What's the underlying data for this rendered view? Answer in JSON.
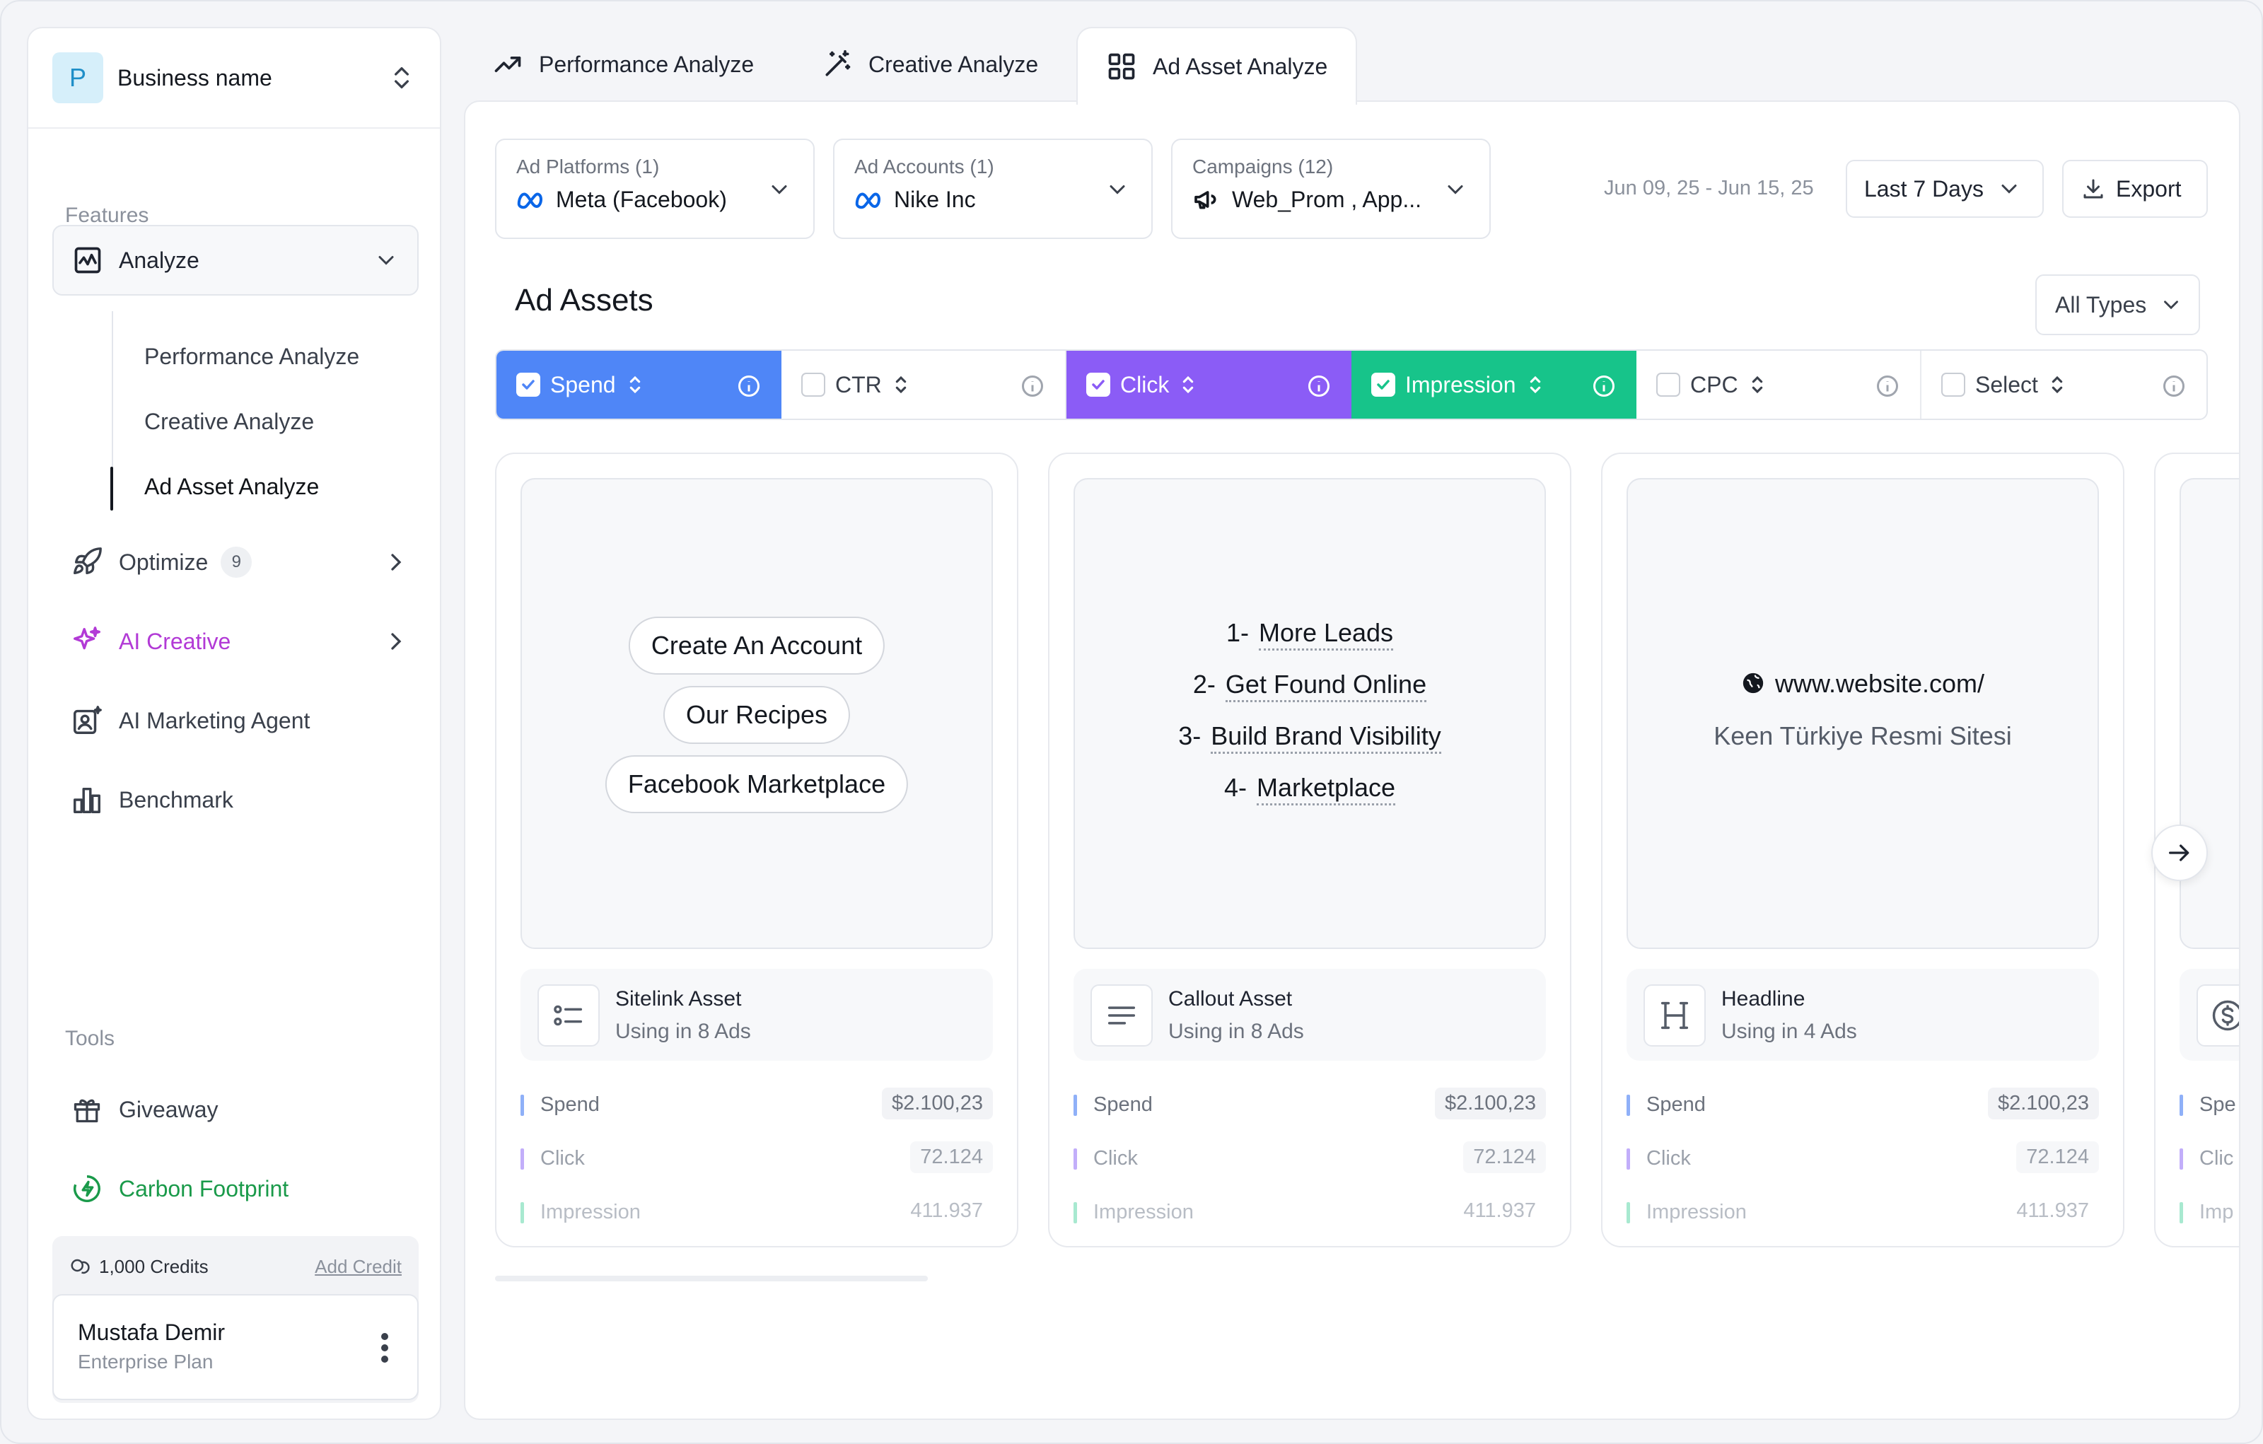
{
  "business": {
    "avatar_letter": "P",
    "name": "Business name"
  },
  "sidebar": {
    "features_label": "Features",
    "analyze_label": "Analyze",
    "sub_items": [
      {
        "label": "Performance Analyze"
      },
      {
        "label": "Creative Analyze"
      },
      {
        "label": "Ad Asset Analyze"
      }
    ],
    "optimize": {
      "label": "Optimize",
      "badge": "9"
    },
    "ai_creative": {
      "label": "AI Creative",
      "color": "#b23ad6"
    },
    "ai_agent": {
      "label": "AI Marketing Agent"
    },
    "benchmark": {
      "label": "Benchmark"
    },
    "tools_label": "Tools",
    "giveaway": {
      "label": "Giveaway"
    },
    "carbon": {
      "label": "Carbon Footprint",
      "color": "#1a9a4a"
    },
    "credits": {
      "amount": "1,000 Credits",
      "add_label": "Add Credit"
    },
    "user": {
      "name": "Mustafa Demir",
      "plan": "Enterprise Plan"
    }
  },
  "tabs": [
    {
      "label": "Performance Analyze",
      "icon": "trend-up-icon"
    },
    {
      "label": "Creative Analyze",
      "icon": "magic-wand-icon"
    },
    {
      "label": "Ad Asset Analyze",
      "icon": "grid-icon",
      "active": true
    }
  ],
  "filters": {
    "platforms": {
      "title": "Ad Platforms (1)",
      "value": "Meta (Facebook)"
    },
    "accounts": {
      "title": "Ad Accounts (1)",
      "value": "Nike Inc"
    },
    "campaigns": {
      "title": "Campaigns (12)",
      "value": "Web_Prom , App..."
    },
    "date_range": "Jun 09, 25 - Jun 15, 25",
    "period": "Last 7 Days",
    "export": "Export"
  },
  "main": {
    "title": "Ad Assets",
    "type_filter": "All Types"
  },
  "metrics": [
    {
      "label": "Spend",
      "checked": true,
      "color": "#4f86f7"
    },
    {
      "label": "CTR",
      "checked": false
    },
    {
      "label": "Click",
      "checked": true,
      "color": "#8b5cf6"
    },
    {
      "label": "Impression",
      "checked": true,
      "color": "#17c48a"
    },
    {
      "label": "CPC",
      "checked": false
    },
    {
      "label": "Select",
      "checked": false
    }
  ],
  "cards": [
    {
      "type": "Sitelink Asset",
      "usage": "Using in 8 Ads",
      "pills": [
        "Create An Account",
        "Our Recipes",
        "Facebook Marketplace"
      ],
      "stats": {
        "spend_label": "Spend",
        "spend": "$2.100,23",
        "click_label": "Click",
        "click": "72.124",
        "impression_label": "Impression",
        "impression": "411.937"
      }
    },
    {
      "type": "Callout Asset",
      "usage": "Using in 8 Ads",
      "callouts": [
        {
          "num": "1-",
          "text": "More Leads"
        },
        {
          "num": "2-",
          "text": "Get Found Online"
        },
        {
          "num": "3-",
          "text": "Build Brand Visibility"
        },
        {
          "num": "4-",
          "text": "Marketplace"
        }
      ],
      "stats": {
        "spend_label": "Spend",
        "spend": "$2.100,23",
        "click_label": "Click",
        "click": "72.124",
        "impression_label": "Impression",
        "impression": "411.937"
      }
    },
    {
      "type": "Headline",
      "usage": "Using in 4 Ads",
      "url": "www.website.com/",
      "headline": "Keen Türkiye Resmi Sitesi",
      "stats": {
        "spend_label": "Spend",
        "spend": "$2.100,23",
        "click_label": "Click",
        "click": "72.124",
        "impression_label": "Impression",
        "impression": "411.937"
      }
    },
    {
      "stats": {
        "spend_label": "Spe",
        "click_label": "Clic",
        "impression_label": "Imp"
      }
    }
  ]
}
